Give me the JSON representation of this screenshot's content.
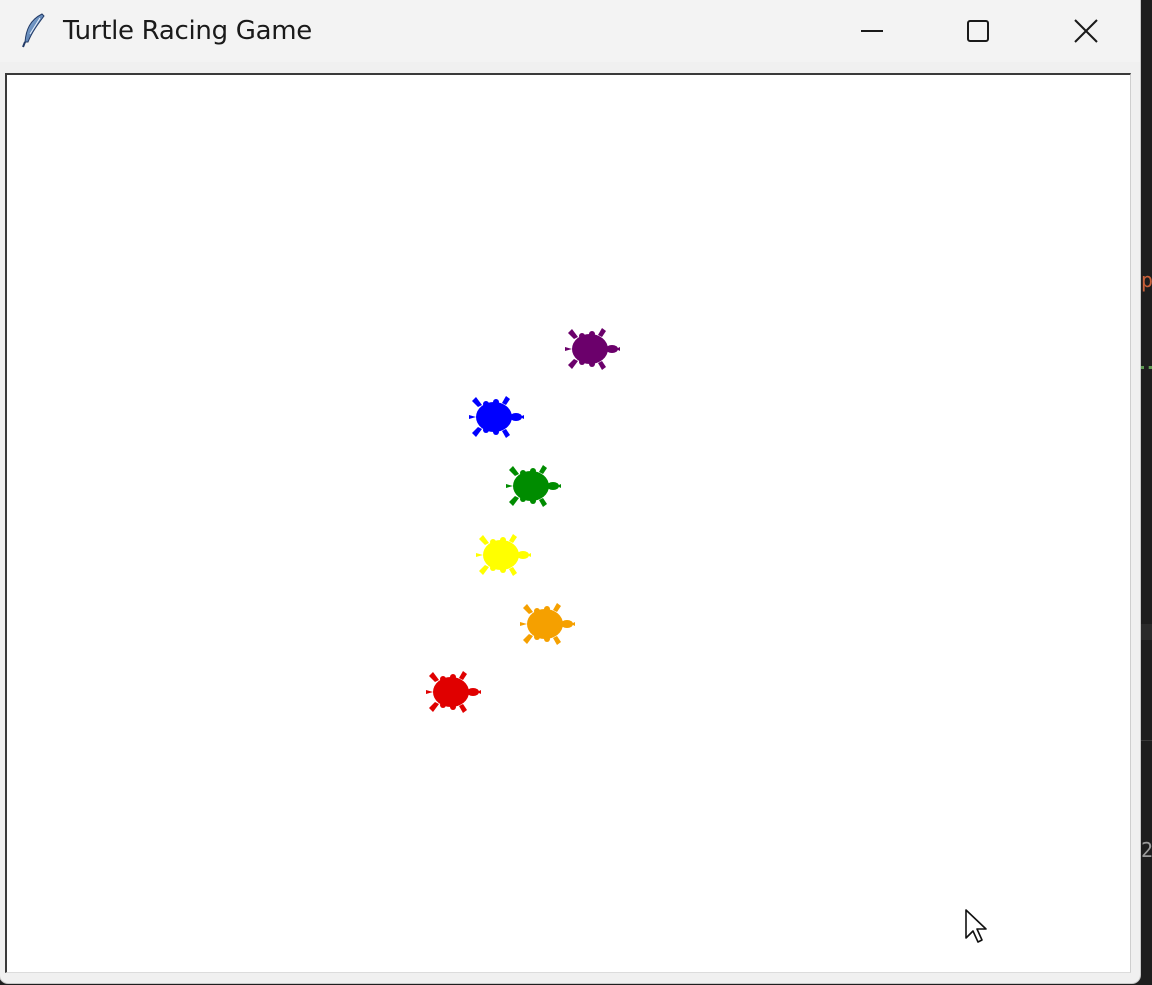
{
  "window": {
    "title": "Turtle Racing Game",
    "controls": {
      "minimize": "minimize-icon",
      "maximize": "maximize-icon",
      "close": "close-icon"
    },
    "app_icon": "feather-icon"
  },
  "race": {
    "turtles": [
      {
        "color": "purple",
        "hex": "#6b006b"
      },
      {
        "color": "blue",
        "hex": "#0000ff"
      },
      {
        "color": "green",
        "hex": "#008c00"
      },
      {
        "color": "yellow",
        "hex": "#ffff00"
      },
      {
        "color": "orange",
        "hex": "#f5a000"
      },
      {
        "color": "red",
        "hex": "#e00000"
      }
    ]
  }
}
